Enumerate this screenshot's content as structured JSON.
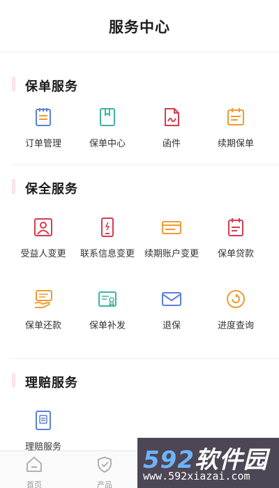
{
  "header": {
    "title": "服务中心"
  },
  "sections": [
    {
      "title": "保单服务",
      "items": [
        {
          "label": "订单管理",
          "icon": "clipboard-list-icon"
        },
        {
          "label": "保单中心",
          "icon": "document-bookmark-icon"
        },
        {
          "label": "函件",
          "icon": "document-pen-icon"
        },
        {
          "label": "续期保单",
          "icon": "calendar-list-icon"
        }
      ]
    },
    {
      "title": "保全服务",
      "items": [
        {
          "label": "受益人变更",
          "icon": "person-frame-icon"
        },
        {
          "label": "联系信息变更",
          "icon": "mobile-phone-icon"
        },
        {
          "label": "续期账户变更",
          "icon": "bank-card-icon"
        },
        {
          "label": "保单贷款",
          "icon": "calendar-doc-icon"
        },
        {
          "label": "保单还款",
          "icon": "hand-receipt-icon"
        },
        {
          "label": "保单补发",
          "icon": "certificate-icon"
        },
        {
          "label": "退保",
          "icon": "envelope-icon"
        },
        {
          "label": "进度查询",
          "icon": "refresh-circle-icon"
        }
      ]
    },
    {
      "title": "理赔服务",
      "items": [
        {
          "label": "理赔服务",
          "icon": "claim-doc-icon"
        }
      ]
    }
  ],
  "tabbar": {
    "items": [
      {
        "label": "首页",
        "icon": "home-icon"
      },
      {
        "label": "产品",
        "icon": "shield-check-icon"
      }
    ]
  },
  "watermark": {
    "brand": "592软件园",
    "url": "www.592xiazai.com"
  },
  "colors": {
    "blue": "#5b7fd9",
    "teal": "#3fb3a2",
    "red": "#d43c4e",
    "orange": "#f09a30",
    "accent_bar": "#fbe4e6"
  }
}
